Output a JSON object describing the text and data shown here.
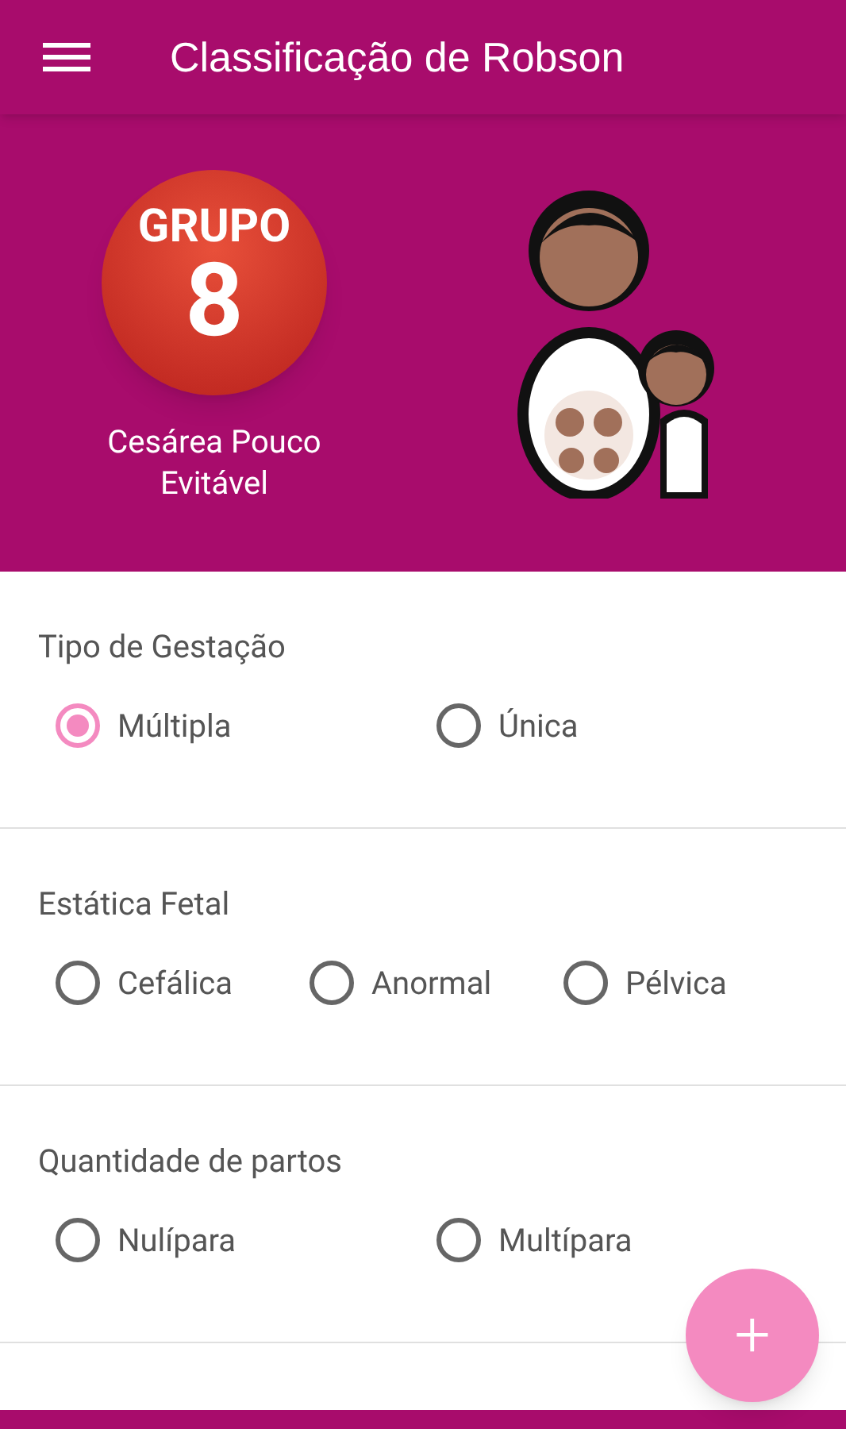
{
  "app_bar": {
    "title": "Classificação de Robson"
  },
  "result": {
    "label": "GRUPO",
    "number": "8",
    "description": "Cesárea Pouco Evitável"
  },
  "questions": [
    {
      "title": "Tipo de Gestação",
      "options": [
        {
          "label": "Múltipla",
          "selected": true
        },
        {
          "label": "Única",
          "selected": false
        }
      ]
    },
    {
      "title": "Estática Fetal",
      "options": [
        {
          "label": "Cefálica",
          "selected": false
        },
        {
          "label": "Anormal",
          "selected": false
        },
        {
          "label": "Pélvica",
          "selected": false
        }
      ]
    },
    {
      "title": "Quantidade de partos",
      "options": [
        {
          "label": "Nulípara",
          "selected": false
        },
        {
          "label": "Multípara",
          "selected": false
        }
      ]
    }
  ],
  "fab": {
    "label": "+"
  }
}
